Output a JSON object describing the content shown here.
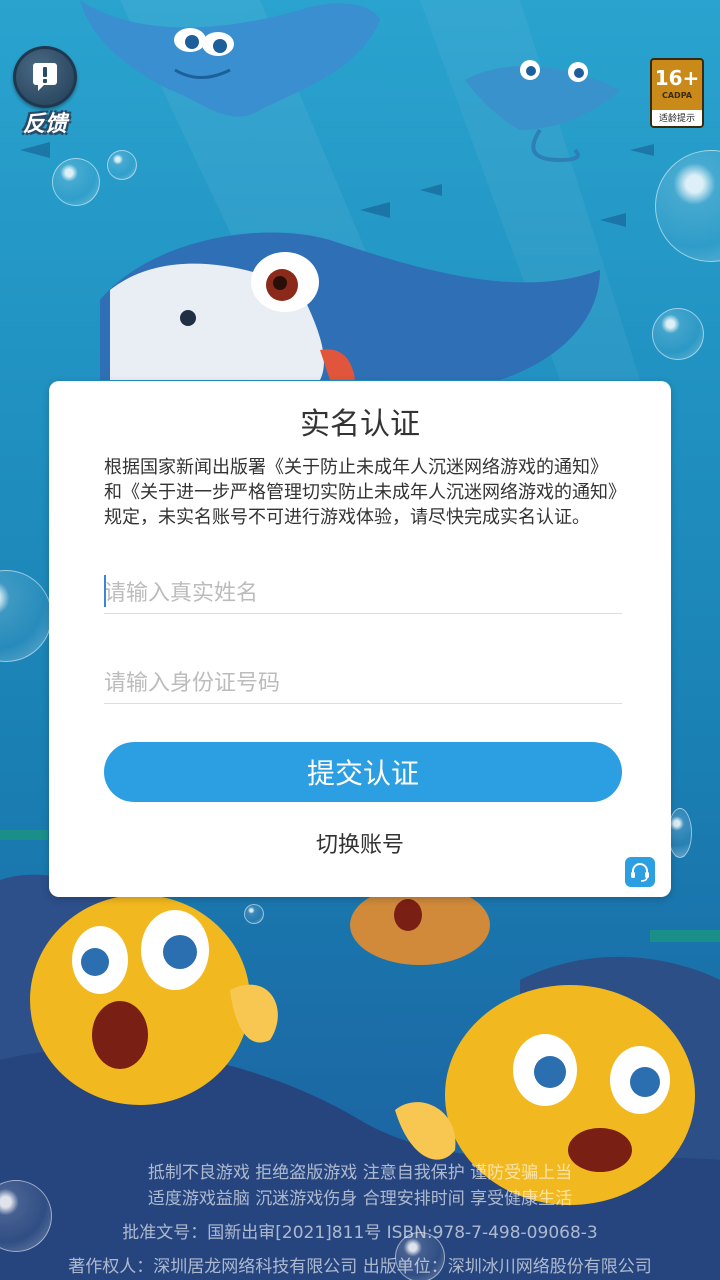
{
  "top_bar": {
    "feedback_label": "反馈",
    "age_rating": {
      "age": "16+",
      "org": "CADPA",
      "tip": "适龄提示"
    }
  },
  "dialog": {
    "title": "实名认证",
    "notice": "根据国家新闻出版署《关于防止未成年人沉迷网络游戏的通知》和《关于进一步严格管理切实防止未成年人沉迷网络游戏的通知》规定，未实名账号不可进行游戏体验，请尽快完成实名认证。",
    "name_field": {
      "value": "",
      "placeholder": "请输入真实姓名"
    },
    "id_field": {
      "value": "",
      "placeholder": "请输入身份证号码"
    },
    "submit_label": "提交认证",
    "switch_account_label": "切换账号"
  },
  "footer": {
    "advisory_line1": "抵制不良游戏  拒绝盗版游戏  注意自我保护  谨防受骗上当",
    "advisory_line2": "适度游戏益脑  沉迷游戏伤身  合理安排时间  享受健康生活",
    "approval": "批准文号：国新出审[2021]811号 ISBN:978-7-498-09068-3",
    "copyright": "著作权人：深圳居龙网络科技有限公司 出版单位：深圳冰川网络股份有限公司"
  },
  "colors": {
    "accent": "#2c9fe2",
    "age_badge": "#c98a1a",
    "ocean_top": "#2aa3cf",
    "ocean_bottom": "#1e5d9a"
  }
}
